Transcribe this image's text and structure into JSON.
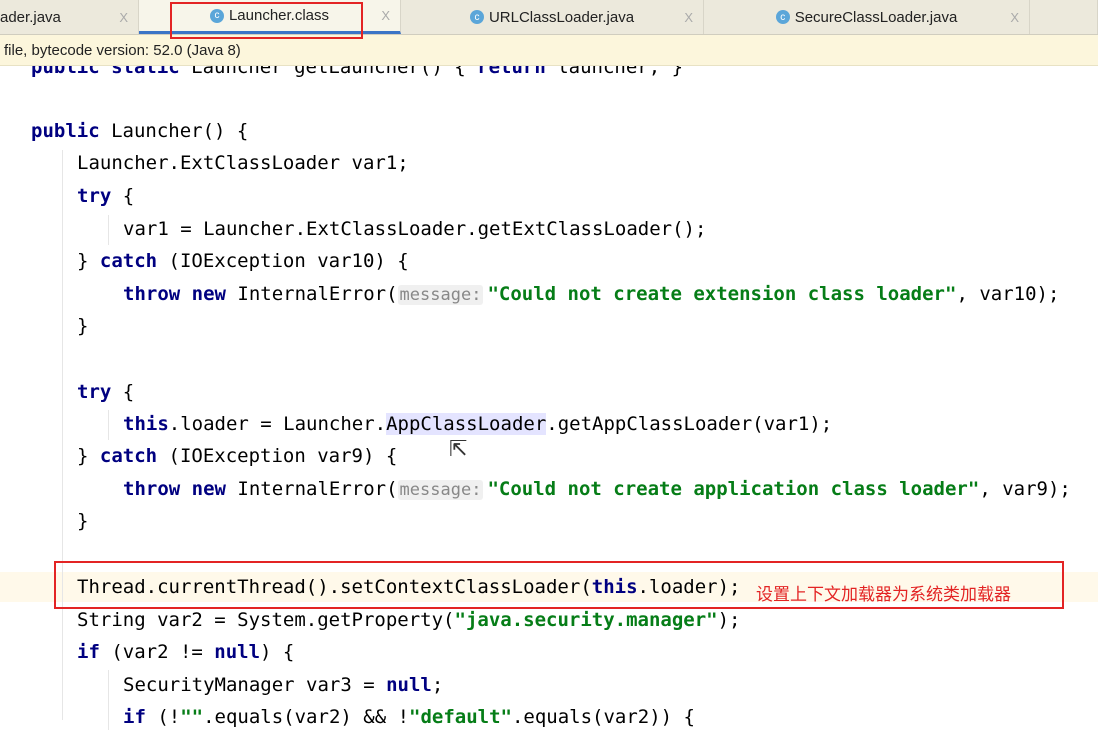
{
  "tabs": [
    {
      "label": "ader.java",
      "icon": "none",
      "active": false
    },
    {
      "label": "Launcher.class",
      "icon": "class-icon",
      "active": true
    },
    {
      "label": "URLClassLoader.java",
      "icon": "class-icon",
      "active": false
    },
    {
      "label": "SecureClassLoader.java",
      "icon": "class-icon",
      "active": false
    }
  ],
  "tab_close": "X",
  "notice": "file, bytecode version: 52.0 (Java 8)",
  "annotation": "设置上下文加载器为系统类加载器",
  "colors": {
    "highlight_box": "#e32424",
    "keyword": "#000080",
    "string": "#067d17",
    "active_tab": "#3b74c6"
  },
  "code": [
    {
      "indent": 0,
      "segs": [
        [
          "public static ",
          "kw"
        ],
        [
          "Launcher getLauncher() { ",
          ""
        ],
        [
          "return ",
          "kw"
        ],
        [
          "launcher; }",
          ""
        ]
      ]
    },
    {
      "indent": 0,
      "segs": [
        [
          "public ",
          "kw"
        ],
        [
          "Launcher() {",
          ""
        ]
      ]
    },
    {
      "indent": 1,
      "segs": [
        [
          "Launcher.ExtClassLoader var1;",
          ""
        ]
      ]
    },
    {
      "indent": 1,
      "segs": [
        [
          "try ",
          "kw"
        ],
        [
          "{",
          ""
        ]
      ]
    },
    {
      "indent": 2,
      "segs": [
        [
          "var1 = Launcher.ExtClassLoader.getExtClassLoader();",
          ""
        ]
      ]
    },
    {
      "indent": 1,
      "segs": [
        [
          "} ",
          ""
        ],
        [
          "catch ",
          "kw"
        ],
        [
          "(IOException var10) {",
          ""
        ]
      ]
    },
    {
      "indent": 2,
      "segs": [
        [
          "throw new ",
          "kw"
        ],
        [
          "InternalError(",
          ""
        ],
        [
          "message:",
          "hint"
        ],
        [
          "\"Could not create extension class loader\"",
          "str"
        ],
        [
          ", var10);",
          ""
        ]
      ]
    },
    {
      "indent": 1,
      "segs": [
        [
          "}",
          ""
        ]
      ]
    },
    {
      "indent": 1,
      "segs": [
        [
          "try ",
          "kw"
        ],
        [
          "{",
          ""
        ]
      ]
    },
    {
      "indent": 2,
      "segs": [
        [
          "this",
          "kw"
        ],
        [
          ".loader = Launcher.",
          ""
        ],
        [
          "AppClassLoader",
          "hl"
        ],
        [
          ".getAppClassLoader(var1);",
          ""
        ]
      ]
    },
    {
      "indent": 1,
      "segs": [
        [
          "} ",
          ""
        ],
        [
          "catch ",
          "kw"
        ],
        [
          "(IOException var9) {",
          ""
        ]
      ]
    },
    {
      "indent": 2,
      "segs": [
        [
          "throw new ",
          "kw"
        ],
        [
          "InternalError(",
          ""
        ],
        [
          "message:",
          "hint"
        ],
        [
          "\"Could not create application class loader\"",
          "str"
        ],
        [
          ", var9);",
          ""
        ]
      ]
    },
    {
      "indent": 1,
      "segs": [
        [
          "}",
          ""
        ]
      ]
    },
    {
      "indent": 1,
      "segs": [
        [
          "Thread.currentThread().setContextClassLoader(",
          ""
        ],
        [
          "this",
          "kw"
        ],
        [
          ".loader);",
          ""
        ]
      ]
    },
    {
      "indent": 1,
      "segs": [
        [
          "String var2 = System.getProperty(",
          ""
        ],
        [
          "\"java.security.manager\"",
          "str"
        ],
        [
          ");",
          ""
        ]
      ]
    },
    {
      "indent": 1,
      "segs": [
        [
          "if ",
          "kw"
        ],
        [
          "(var2 != ",
          ""
        ],
        [
          "null",
          "kw"
        ],
        [
          ") {",
          ""
        ]
      ]
    },
    {
      "indent": 2,
      "segs": [
        [
          "SecurityManager var3 = ",
          ""
        ],
        [
          "null",
          "kw"
        ],
        [
          ";",
          ""
        ]
      ]
    },
    {
      "indent": 2,
      "segs": [
        [
          "if ",
          "kw"
        ],
        [
          "(!",
          ""
        ],
        [
          "\"\"",
          "str"
        ],
        [
          ".equals(var2) && !",
          ""
        ],
        [
          "\"default\"",
          "str"
        ],
        [
          ".equals(var2)) {",
          ""
        ]
      ]
    }
  ]
}
